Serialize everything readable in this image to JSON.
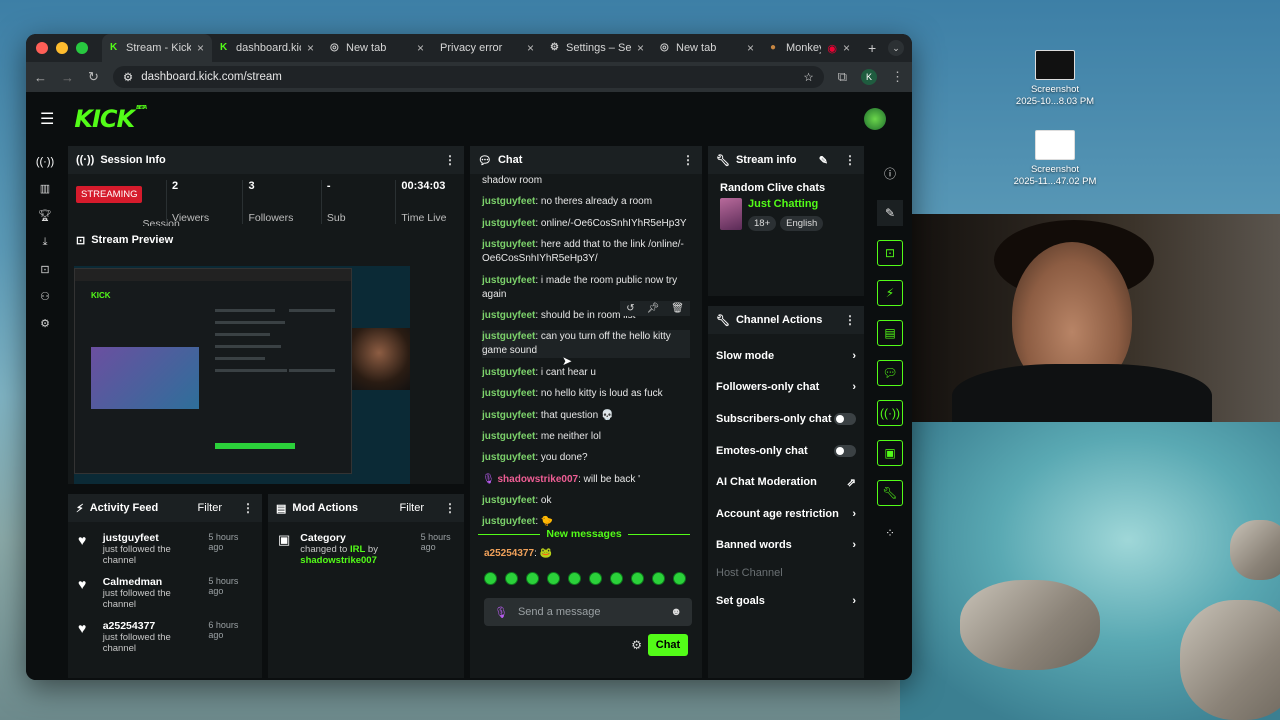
{
  "colors": {
    "accent": "#53fc18",
    "streaming": "#d61b2c",
    "panel": "#141819"
  },
  "desktop": {
    "icons": [
      {
        "name": "Screenshot",
        "sub": "2025-10...8.03 PM"
      },
      {
        "name": "Screenshot",
        "sub": "2025-11...47.02 PM"
      }
    ]
  },
  "browser": {
    "tabs": [
      {
        "title": "Stream - Kick",
        "icon": "kick-icon",
        "active": true
      },
      {
        "title": "dashboard.kick",
        "icon": "kick-icon",
        "active": false
      },
      {
        "title": "New tab",
        "icon": "globe-icon",
        "active": false
      },
      {
        "title": "Privacy error",
        "icon": "",
        "active": false
      },
      {
        "title": "Settings – Se",
        "icon": "gear-icon",
        "active": false
      },
      {
        "title": "New tab",
        "icon": "globe-icon",
        "active": false
      },
      {
        "title": "Monkey:",
        "icon": "monkey-icon",
        "active": false
      }
    ],
    "url": "dashboard.kick.com/stream",
    "profile_initial": "K"
  },
  "kick": {
    "logo": "KICK",
    "beta": "BETA",
    "session": {
      "title": "Session Info",
      "status": "STREAMING",
      "status_label": "Session",
      "viewers": "2",
      "viewers_label": "Viewers",
      "followers": "3",
      "followers_label": "Followers",
      "sub": "-",
      "sub_label": "Sub",
      "time": "00:34:03",
      "time_label": "Time Live"
    },
    "preview": {
      "title": "Stream Preview"
    },
    "activity": {
      "title": "Activity Feed",
      "filter": "Filter",
      "items": [
        {
          "user": "justguyfeet",
          "text": "just followed the channel",
          "time": "5 hours ago"
        },
        {
          "user": "Calmedman",
          "text": "just followed the channel",
          "time": "5 hours ago"
        },
        {
          "user": "a25254377",
          "text": "just followed the channel",
          "time": "6 hours ago"
        }
      ]
    },
    "mod": {
      "title": "Mod Actions",
      "filter": "Filter",
      "item": {
        "title": "Category",
        "time": "5 hours ago",
        "changed": "changed to",
        "value": "IRL",
        "by": "by",
        "user": "shadowstrike007"
      }
    },
    "chat": {
      "title": "Chat",
      "first_line": "shadow room",
      "messages": [
        {
          "user": "justguyfeet",
          "text": "no theres already a room"
        },
        {
          "user": "justguyfeet",
          "text": "online/-Oe6CosSnhIYhR5eHp3Y"
        },
        {
          "user": "justguyfeet",
          "text": "here add that to the link /online/-Oe6CosSnhIYhR5eHp3Y/"
        },
        {
          "user": "justguyfeet",
          "text": "i made the room public now try again"
        },
        {
          "user": "justguyfeet",
          "text": "should be in room list"
        },
        {
          "user": "justguyfeet",
          "text": "can you turn off the hello kitty game sound"
        },
        {
          "user": "justguyfeet",
          "text": "i cant hear u"
        },
        {
          "user": "justguyfeet",
          "text": "no hello kitty is loud as fuck"
        },
        {
          "user": "justguyfeet",
          "text": "that question 💀"
        },
        {
          "user": "justguyfeet",
          "text": "me neither lol"
        },
        {
          "user": "justguyfeet",
          "text": "you done?"
        },
        {
          "user": "shadowstrike007",
          "text": "will be back '"
        },
        {
          "user": "justguyfeet",
          "text": "ok"
        },
        {
          "user": "justguyfeet",
          "text": "🐤"
        }
      ],
      "new_messages": "New messages",
      "last": {
        "user": "a25254377",
        "text": "🐸"
      },
      "placeholder": "Send a message",
      "send": "Chat"
    },
    "stream_info": {
      "title": "Stream info",
      "stream_title": "Random Clive chats",
      "category": "Just Chatting",
      "tags": [
        "18+",
        "English"
      ]
    },
    "channel_actions": {
      "title": "Channel Actions",
      "items": [
        {
          "label": "Slow mode",
          "control": "chevron"
        },
        {
          "label": "Followers-only chat",
          "control": "chevron"
        },
        {
          "label": "Subscribers-only chat",
          "control": "toggle"
        },
        {
          "label": "Emotes-only chat",
          "control": "toggle"
        },
        {
          "label": "AI Chat Moderation",
          "control": "external"
        },
        {
          "label": "Account age restriction",
          "control": "chevron"
        },
        {
          "label": "Banned words",
          "control": "chevron"
        },
        {
          "label": "Host Channel",
          "control": "none",
          "disabled": true
        },
        {
          "label": "Set goals",
          "control": "chevron"
        }
      ]
    }
  }
}
